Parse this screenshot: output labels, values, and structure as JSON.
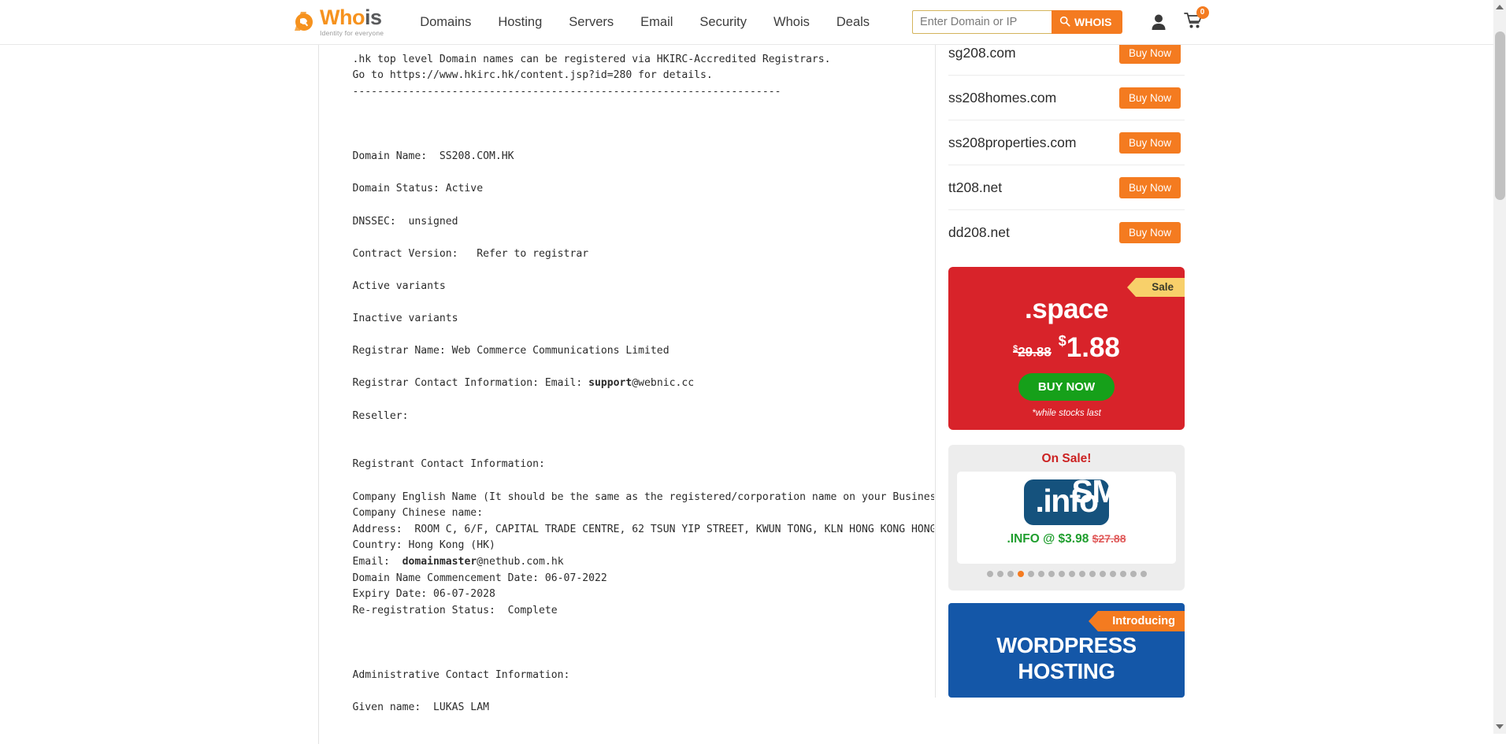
{
  "header": {
    "logo": {
      "word_primary": "Who",
      "word_secondary": "is",
      "tagline": "Identity for everyone"
    },
    "nav": [
      {
        "label": "Domains"
      },
      {
        "label": "Hosting"
      },
      {
        "label": "Servers"
      },
      {
        "label": "Email"
      },
      {
        "label": "Security"
      },
      {
        "label": "Whois"
      },
      {
        "label": "Deals"
      }
    ],
    "search": {
      "placeholder": "Enter Domain or IP",
      "value": "",
      "button_label": "WHOIS"
    },
    "cart_count": "0"
  },
  "whois": {
    "text": "    ---------------------------------------------------------------------\n    .hk top level Domain names can be registered via HKIRC-Accredited Registrars.\n    Go to https://www.hkirc.hk/content.jsp?id=280 for details.\n    ---------------------------------------------------------------------\n\n\n\n    Domain Name:  SS208.COM.HK\n\n    Domain Status: Active\n\n    DNSSEC:  unsigned\n\n    Contract Version:   Refer to registrar\n\n    Active variants\n\n    Inactive variants\n\n    Registrar Name: Web Commerce Communications Limited\n\n    Registrar Contact Information: Email: ",
    "registrar_email_user": "support",
    "registrar_email_domain": "@webnic.cc",
    "text2": "\n\n    Reseller:\n\n\n    Registrant Contact Information:\n\n    Company English Name (It should be the same as the registered/corporation name on your Business Re\n    Company Chinese name:\n    Address:  ROOM C, 6/F, CAPITAL TRADE CENTRE, 62 TSUN YIP STREET, KWUN TONG, KLN HONG KONG HONG KON\n    Country: Hong Kong (HK)\n    Email:  ",
    "registrant_email_user": "domainmaster",
    "registrant_email_domain": "@nethub.com.hk",
    "text3": "\n    Domain Name Commencement Date: 06-07-2022\n    Expiry Date: 06-07-2028\n    Re-registration Status:  Complete\n\n\n\n    Administrative Contact Information:\n\n    Given name:  LUKAS LAM"
  },
  "sidebar": {
    "suggestions": [
      {
        "domain": "sg208.com",
        "buy_label": "Buy Now"
      },
      {
        "domain": "ss208homes.com",
        "buy_label": "Buy Now"
      },
      {
        "domain": "ss208properties.com",
        "buy_label": "Buy Now"
      },
      {
        "domain": "tt208.net",
        "buy_label": "Buy Now"
      },
      {
        "domain": "dd208.net",
        "buy_label": "Buy Now"
      }
    ],
    "promo_space": {
      "ribbon": "Sale",
      "tld": ".space",
      "old_price": "29.88",
      "old_price_symbol": "$",
      "new_price": "1.88",
      "new_price_symbol": "$",
      "buy_label": "BUY NOW",
      "note": "*while stocks last"
    },
    "on_sale": {
      "title": "On Sale!",
      "logo_text": ".info",
      "logo_sm": "SM",
      "price_text": ".INFO @ $3.98",
      "old_price": "$27.88",
      "dot_count": 16,
      "active_dot": 3
    },
    "wp_banner": {
      "ribbon": "Introducing",
      "line1": "WORDPRESS",
      "line2": "HOSTING"
    }
  },
  "colors": {
    "brand_orange": "#f47b20",
    "promo_red": "#d8232a",
    "buy_green": "#16a01a",
    "info_blue": "#15527d",
    "wp_blue": "#1457a8"
  }
}
